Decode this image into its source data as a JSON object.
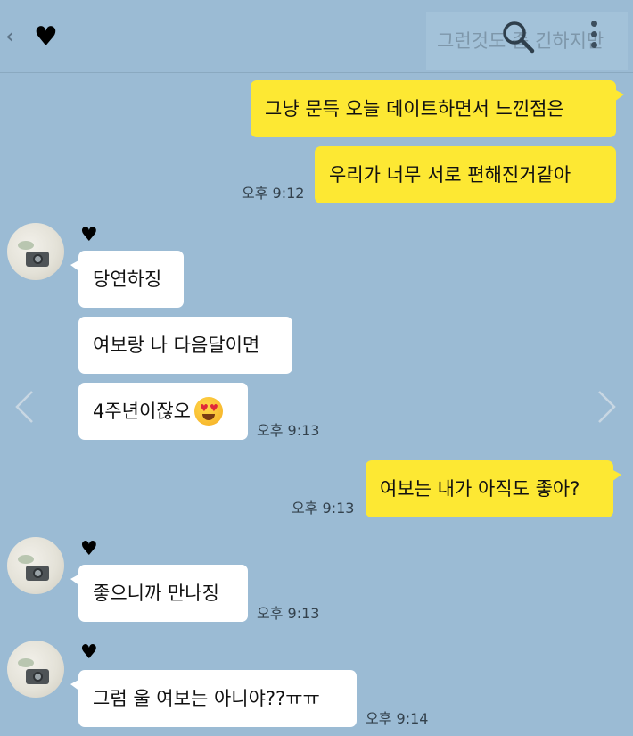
{
  "header": {
    "back_symbol": "‹",
    "title": "♥",
    "preview_text": "그런것도 좀 긴하지만",
    "icons": [
      "back-icon",
      "search-icon",
      "more-vertical-icon"
    ]
  },
  "messages": [
    {
      "from": "me",
      "text": "그냥 문득 오늘 데이트하면서 느낀점은"
    },
    {
      "from": "me",
      "text": "우리가 너무 서로 편해진거같아",
      "time": "오후 9:12"
    },
    {
      "from": "other",
      "sender": "♥",
      "text": "당연하징"
    },
    {
      "from": "other",
      "text": "여보랑 나 다음달이면"
    },
    {
      "from": "other",
      "text": "4주년이잖오",
      "emoji": "heart-eyes-emoji",
      "time": "오후 9:13"
    },
    {
      "from": "me",
      "text": "여보는 내가 아직도 좋아?",
      "time": "오후 9:13"
    },
    {
      "from": "other",
      "sender": "♥",
      "text": "좋으니까 만나징",
      "time": "오후 9:13"
    },
    {
      "from": "other",
      "sender": "♥",
      "text": "그럼 울 여보는 아니야??ㅠㅠ",
      "time": "오후 9:14"
    }
  ],
  "colors": {
    "background": "#9bbbd4",
    "my_bubble": "#fde833",
    "other_bubble": "#ffffff"
  }
}
